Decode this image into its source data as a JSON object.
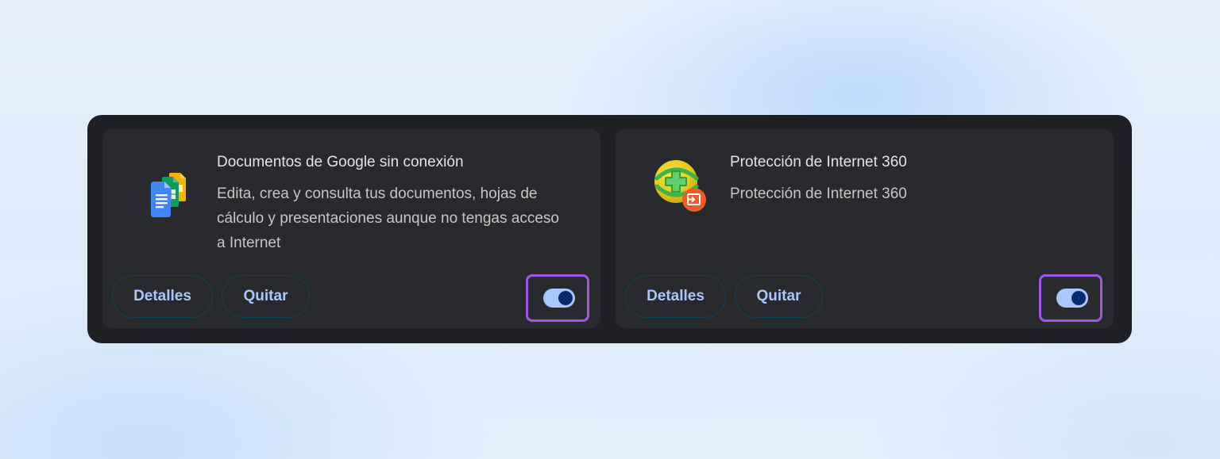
{
  "extensions": [
    {
      "title": "Documentos de Google sin conexión",
      "description": "Edita, crea y consulta tus documentos, hojas de cálculo y presentaciones aunque no tengas acceso a Internet",
      "icon": "google-docs-offline-icon",
      "details_label": "Detalles",
      "remove_label": "Quitar",
      "enabled": true
    },
    {
      "title": "Protección de Internet 360",
      "description": "Protección de Internet 360",
      "icon": "360-internet-protection-icon",
      "details_label": "Detalles",
      "remove_label": "Quitar",
      "enabled": true
    }
  ],
  "colors": {
    "panel": "#1f2023",
    "card": "#292a2d",
    "accent": "#a8c7fa",
    "toggle_knob": "#062e6f",
    "highlight": "#a356e6"
  }
}
